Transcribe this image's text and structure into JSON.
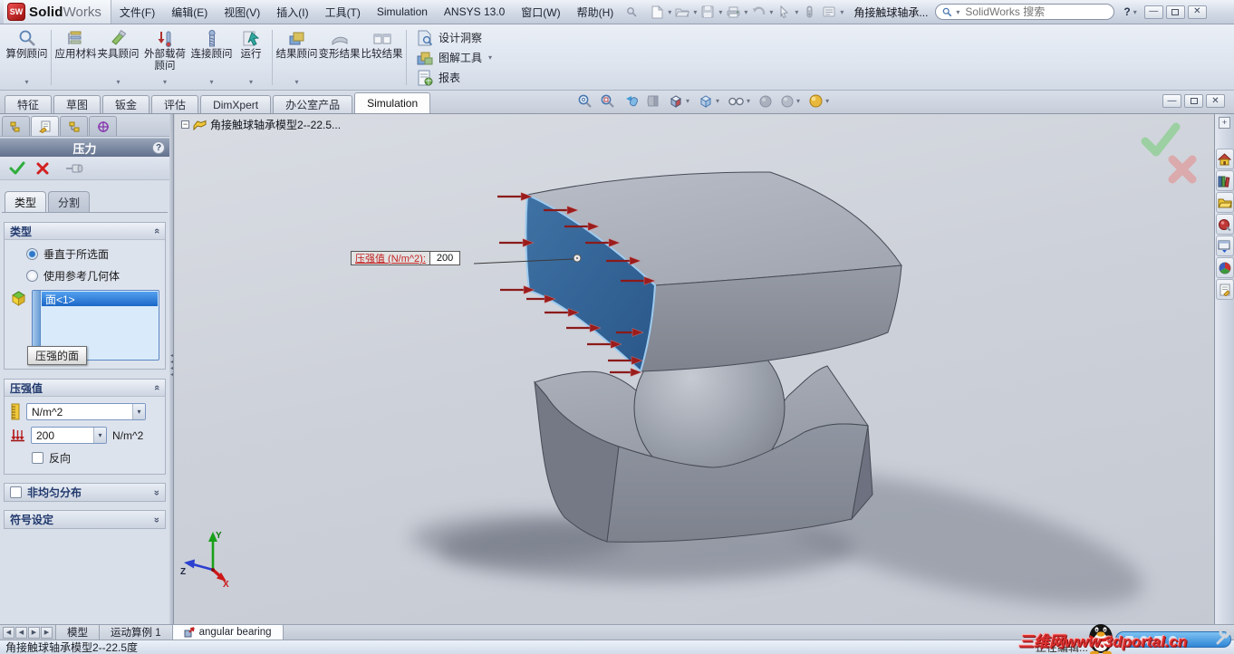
{
  "titlebar": {
    "logo_sw": "SW",
    "logo_solid": "Solid",
    "logo_works": "Works",
    "menus": [
      "文件(F)",
      "编辑(E)",
      "视图(V)",
      "插入(I)",
      "工具(T)",
      "Simulation",
      "ANSYS 13.0",
      "窗口(W)",
      "帮助(H)"
    ],
    "doc_title": "角接触球轴承...",
    "search_placeholder": "SolidWorks 搜索",
    "help_label": "?"
  },
  "ribbon": {
    "buttons": [
      {
        "label": "算例顾问"
      },
      {
        "label": "应用材料"
      },
      {
        "label": "夹具顾问"
      },
      {
        "label": "外部载荷顾问"
      },
      {
        "label": "连接顾问"
      },
      {
        "label": "运行"
      },
      {
        "label": "结果顾问"
      },
      {
        "label": "变形结果"
      },
      {
        "label": "比较结果"
      }
    ],
    "stack": [
      "设计洞察",
      "图解工具",
      "报表"
    ]
  },
  "tabbar": {
    "tabs": [
      "特征",
      "草图",
      "钣金",
      "评估",
      "DimXpert",
      "办公室产品",
      "Simulation"
    ],
    "active_tab": "Simulation"
  },
  "panel": {
    "title": "压力",
    "help_label": "?",
    "tabs": [
      "类型",
      "分割"
    ],
    "type_section": {
      "header": "类型",
      "radio_normal": "垂直于所选面",
      "radio_reference": "使用参考几何体",
      "selected_face": "面<1>",
      "tooltip": "压强的面"
    },
    "value_section": {
      "header": "压强值",
      "unit_selected": "N/m^2",
      "value": "200",
      "unit_suffix": "N/m^2",
      "reverse_label": "反向"
    },
    "collapsed_sections": [
      "非均匀分布",
      "符号设定"
    ]
  },
  "viewport": {
    "tree_root": "角接触球轴承模型2--22.5...",
    "callout": {
      "label": "压强值 (N/m^2):",
      "value": "200"
    },
    "triad": {
      "x": "X",
      "y": "Y",
      "z": "Z"
    }
  },
  "bottombar": {
    "tabs": [
      "模型",
      "运动算例 1",
      "angular bearing"
    ],
    "active_tab": "angular bearing"
  },
  "statusbar": {
    "model_name": "角接触球轴承模型2--22.5度",
    "editing": "正在编辑...",
    "watermark": "三维网www.3dportal.cn"
  },
  "colors": {
    "selected_face": "#2f5f91",
    "pressure_arrow": "#9b1c1c",
    "selection_highlight": "#1b67c6"
  }
}
